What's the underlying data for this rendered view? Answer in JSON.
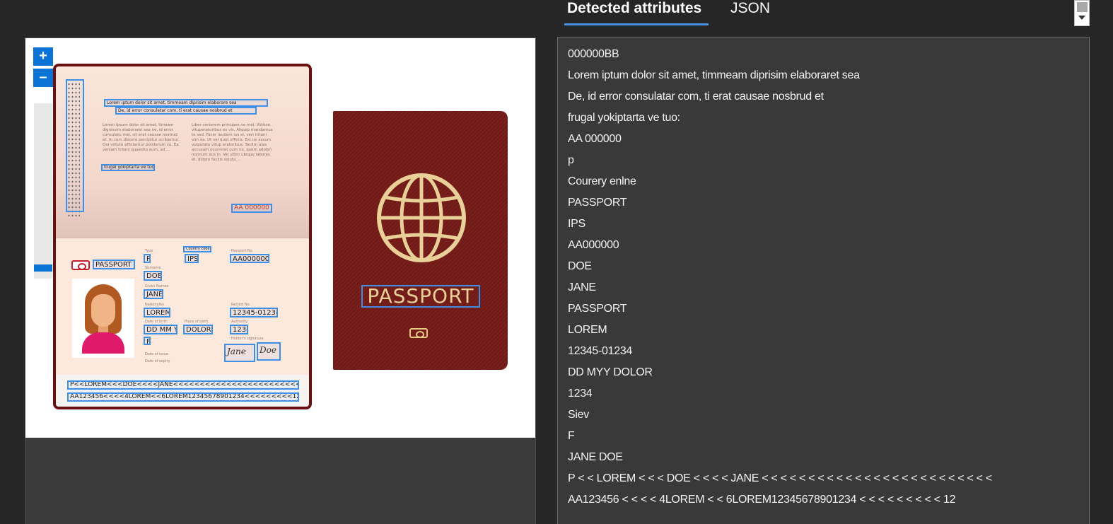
{
  "tabs": [
    {
      "label": "Detected attributes",
      "active": true
    },
    {
      "label": "JSON",
      "active": false
    }
  ],
  "zoom": {
    "in_label": "+",
    "out_label": "–"
  },
  "document": {
    "cover_title": "PASSPORT",
    "page": {
      "header_box_1": "Lorem iptum dolor sit amet, timmeam diprisim elaborare sea",
      "header_box_2": "De, id error consulatar com, ti erat causae nosbrud et",
      "fine_left": "Lorem ipsum dolor sit amet, timeam dignissim elaboraret sea ne, id error consulatu mei, sit erat causae nostrud et. In cum discere percipitur scribentur. Qui virtute efficiantur ponderum cu. Ea veniam tritani quaestio eum, ad ...",
      "fine_right": "Liber verterem principes ne mei. Vidisse vituperatoribus ex vis. Aliquip mandamus te sed. Facer laudem ius ei, veri tritani vim ea. Ut vel quot officiis. Est ne assum vulputate vitup eratoribus. Tacitm alas accusam ocurreret cum no, quem adolim nonnum eos in. Vel ultim ubique labores et, dolore facilis soluta ...",
      "fine_box": "frugal yokiptarta ve tuo:",
      "number_box": "AA 000000",
      "passport_label": "PASSPORT",
      "type_value": "P",
      "code_value": "IPS",
      "passport_no": "AA000000",
      "surname": "DOE",
      "given_names": "JANE",
      "nationality": "LOREM",
      "record_no": "12345-01234",
      "date_of_birth": "DD MM YY",
      "place_of_birth": "DOLOR",
      "authority": "1234",
      "sex": "F",
      "signature_1": "Jane",
      "signature_2": "Doe",
      "small_labels": {
        "type": "Type",
        "code": "Country code",
        "passport_no": "Passport No.",
        "surname": "Surname",
        "given_names": "Given Names",
        "nationality": "Nationality",
        "record_no": "Record No.",
        "dob": "Date of birth",
        "pob": "Place of birth",
        "authority": "Authority",
        "holder_signature": "Holder's signature",
        "date_of_issue": "Date of issue",
        "date_of_expiry": "Date of expiry"
      },
      "mrz_line_1": "P<<LOREM<<<DOE<<<<JANE<<<<<<<<<<<<<<<<<<<<<<<<<",
      "mrz_line_2": "AA123456<<<<4LOREM<<6LOREM12345678901234<<<<<<<<<12"
    }
  },
  "detected_text_lines": [
    "000000BB",
    "Lorem iptum dolor sit amet, timmeam diprisim elaboraret sea",
    "De, id error consulatar com, ti erat causae nosbrud et",
    "frugal yokiptarta ve tuo:",
    "AA 000000",
    "p",
    "Courery enlne",
    "PASSPORT",
    "IPS",
    "AA000000",
    "DOE",
    "JANE",
    "PASSPORT",
    "LOREM",
    "12345-01234",
    "DD MYY DOLOR",
    "1234",
    "Siev",
    "F",
    "JANE DOE",
    "P < < LOREM < < < DOE < < < < JANE < < < < < < < < < < < < < < < < < < < < < < < < <",
    "AA123456 < < < < 4LOREM < < 6LOREM12345678901234 < < < < < < < < < 12"
  ],
  "colors": {
    "accent": "#4a90e2",
    "zoom_button": "#0a74d6",
    "bbox": "#3f8fe6",
    "cover": "#6e1a17",
    "cover_gold": "#e9cf98",
    "background": "#262626",
    "panel": "#393939"
  }
}
